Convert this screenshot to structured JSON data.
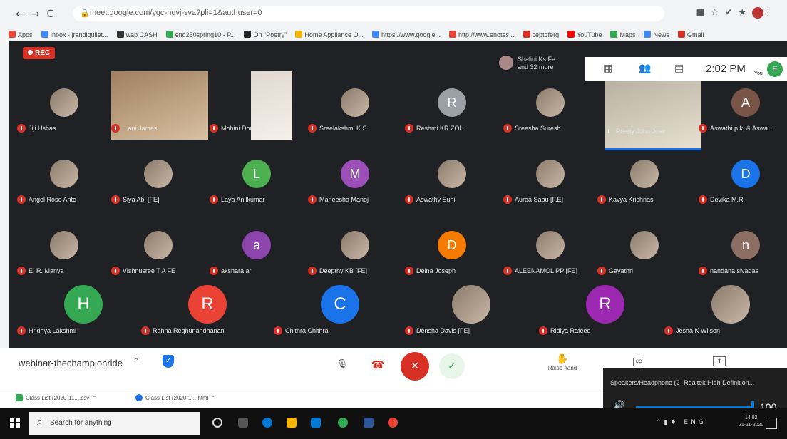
{
  "browser": {
    "url": "meet.google.com/ygc-hqvj-sva?pli=1&authuser=0",
    "bookmarks": [
      {
        "label": "Apps",
        "color": "#e8453c"
      },
      {
        "label": "Inbox - jrandiquilet...",
        "color": "#4285f4"
      },
      {
        "label": "wap CASH",
        "color": "#333333"
      },
      {
        "label": "eng250spring10 - P...",
        "color": "#34a853"
      },
      {
        "label": "On \"Poetry\"",
        "color": "#222222"
      },
      {
        "label": "Home Appliance O...",
        "color": "#f4b400"
      },
      {
        "label": "https://www.google...",
        "color": "#4285f4"
      },
      {
        "label": "http://www.enotes...",
        "color": "#ea4335"
      },
      {
        "label": "ceptoferg",
        "color": "#d93025"
      },
      {
        "label": "YouTube",
        "color": "#ff0000"
      },
      {
        "label": "Maps",
        "color": "#34a853"
      },
      {
        "label": "News",
        "color": "#4285f4"
      },
      {
        "label": "Gmail",
        "color": "#d93025"
      }
    ]
  },
  "meet": {
    "rec_label": "REC",
    "overflow_line1": "Shalini Ks Fe",
    "overflow_line2": "and 32 more",
    "clock": "2:02 PM",
    "you_label": "You",
    "self_initial": "E",
    "meeting_code": "webinar-thechampionride",
    "raise_hand": "Raise hand",
    "participants": [
      {
        "name": "Jiji Ushas",
        "kind": "photo"
      },
      {
        "name": "...ani James",
        "kind": "video"
      },
      {
        "name": "Mohini Dominic",
        "kind": "video-light"
      },
      {
        "name": "Sreelakshmi K S",
        "kind": "photo"
      },
      {
        "name": "Reshmi KR ZOL",
        "kind": "initial",
        "initial": "R",
        "color": "#9aa0a6"
      },
      {
        "name": "Sreesha Suresh",
        "kind": "photo"
      },
      {
        "name": "Preety John Jose",
        "kind": "video-green"
      },
      {
        "name": "Aswathi p.k, & Aswa...",
        "kind": "initial",
        "initial": "A",
        "color": "#795548"
      },
      {
        "name": "Angel Rose Anto",
        "kind": "photo"
      },
      {
        "name": "Siya Abi [FE]",
        "kind": "photo"
      },
      {
        "name": "Laya Anilkumar",
        "kind": "initial",
        "initial": "L",
        "color": "#4caf50"
      },
      {
        "name": "Maneesha Manoj",
        "kind": "initial",
        "initial": "M",
        "color": "#9c4fb8"
      },
      {
        "name": "Aswathy Sunil",
        "kind": "photo"
      },
      {
        "name": "Aurea Sabu [F.E]",
        "kind": "photo"
      },
      {
        "name": "Kavya Krishnas",
        "kind": "photo"
      },
      {
        "name": "Devika M.R",
        "kind": "initial",
        "initial": "D",
        "color": "#1a73e8"
      },
      {
        "name": "E. R. Manya",
        "kind": "photo"
      },
      {
        "name": "Vishnusree T A FE",
        "kind": "photo"
      },
      {
        "name": "akshara ar",
        "kind": "initial",
        "initial": "a",
        "color": "#8e44ad"
      },
      {
        "name": "Deepthy KB [FE]",
        "kind": "photo"
      },
      {
        "name": "Delna Joseph",
        "kind": "initial",
        "initial": "D",
        "color": "#f57c00"
      },
      {
        "name": "ALEENAMOL PP [FE]",
        "kind": "photo"
      },
      {
        "name": "Gayathri",
        "kind": "photo"
      },
      {
        "name": "nandana sivadas",
        "kind": "initial",
        "initial": "n",
        "color": "#8d6e63"
      },
      {
        "name": "Hridhya Lakshmi",
        "kind": "initial",
        "initial": "H",
        "color": "#34a853"
      },
      {
        "name": "Rahna Reghunandhanan",
        "kind": "initial",
        "initial": "R",
        "color": "#ea4335"
      },
      {
        "name": "Chithra Chithra",
        "kind": "initial",
        "initial": "C",
        "color": "#1a73e8"
      },
      {
        "name": "Densha Davis [FE]",
        "kind": "photo"
      },
      {
        "name": "Ridiya Rafeeq",
        "kind": "initial",
        "initial": "R",
        "color": "#9c27b0"
      },
      {
        "name": "Jesna K Wilson",
        "kind": "photo"
      }
    ]
  },
  "volume": {
    "title": "Speakers/Headphone (2- Realtek High Definition...",
    "value": "100",
    "level_percent": 100
  },
  "downloads": [
    {
      "label": "Class List (2020-11....csv"
    },
    {
      "label": "Class List (2020-1....html"
    }
  ],
  "taskbar": {
    "search_placeholder": "Search for anything",
    "time": "14:02",
    "date": "21-11-2020"
  },
  "colors": {
    "meet_bg": "#202124",
    "rec": "#d93025",
    "end_call": "#d93025",
    "accent": "#1a73e8"
  }
}
